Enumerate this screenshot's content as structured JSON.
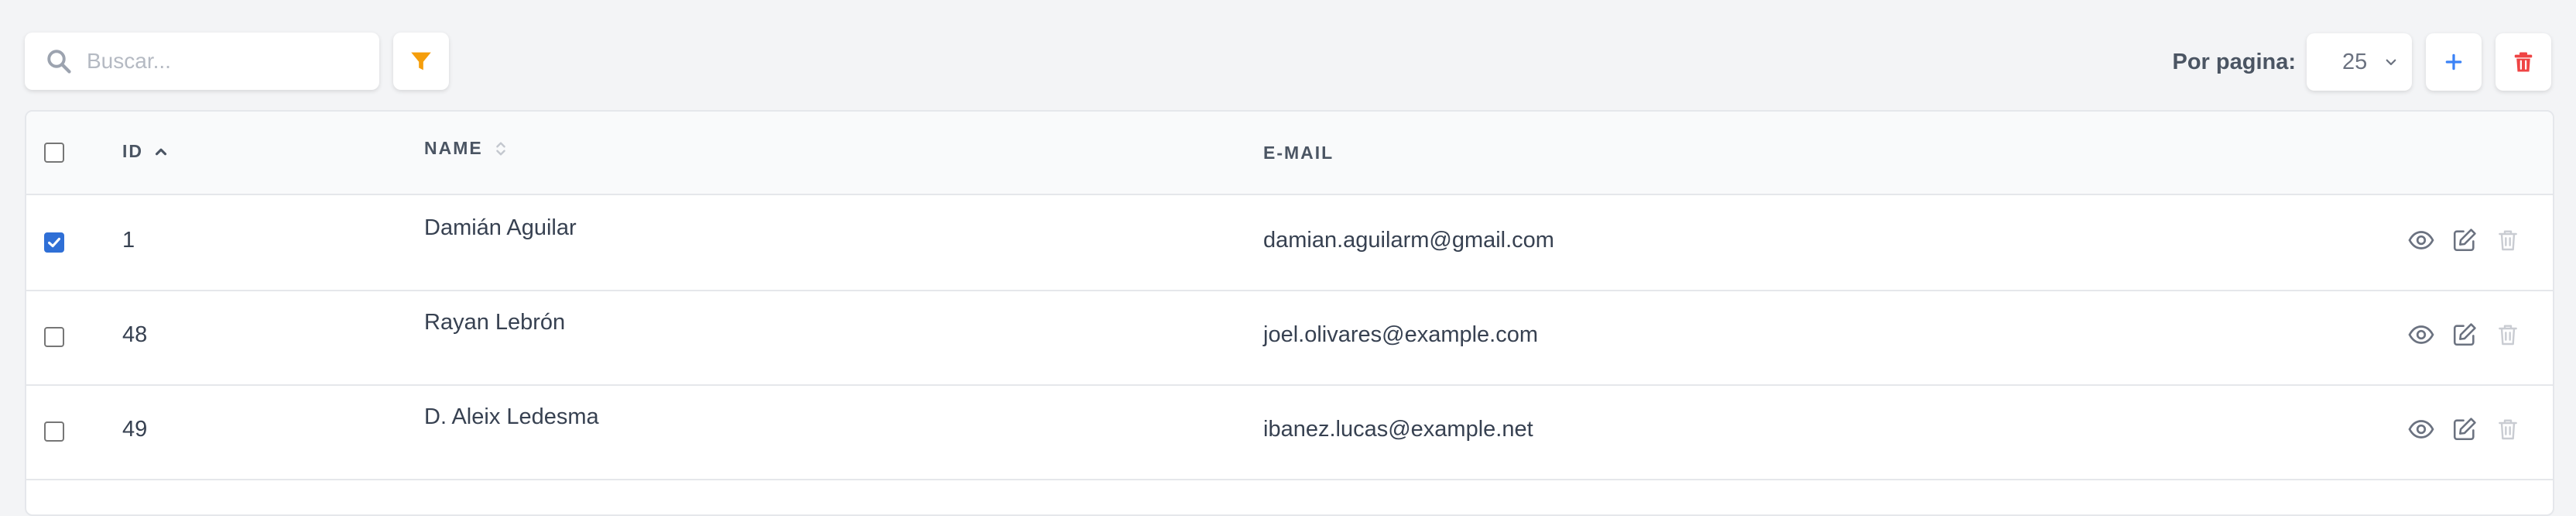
{
  "search": {
    "placeholder": "Buscar..."
  },
  "toolbar": {
    "per_page_label": "Por pagina:",
    "per_page_value": "25"
  },
  "table": {
    "columns": {
      "id": "ID",
      "name": "NAME",
      "email": "E-MAIL"
    },
    "rows": [
      {
        "id": "1",
        "name": "Damián Aguilar",
        "email": "damian.aguilarm@gmail.com",
        "selected": true
      },
      {
        "id": "48",
        "name": "Rayan Lebrón",
        "email": "joel.olivares@example.com",
        "selected": false
      },
      {
        "id": "49",
        "name": "D. Aleix Ledesma",
        "email": "ibanez.lucas@example.net",
        "selected": false
      }
    ]
  },
  "colors": {
    "filter": "#f59e0b",
    "add": "#3b82f6",
    "delete": "#ef4444",
    "checkbox_checked": "#2f6fd6"
  },
  "icons": {
    "search": "search-icon",
    "filter": "funnel-icon",
    "add": "plus-icon",
    "delete": "trash-icon",
    "view": "eye-icon",
    "edit": "edit-icon"
  }
}
